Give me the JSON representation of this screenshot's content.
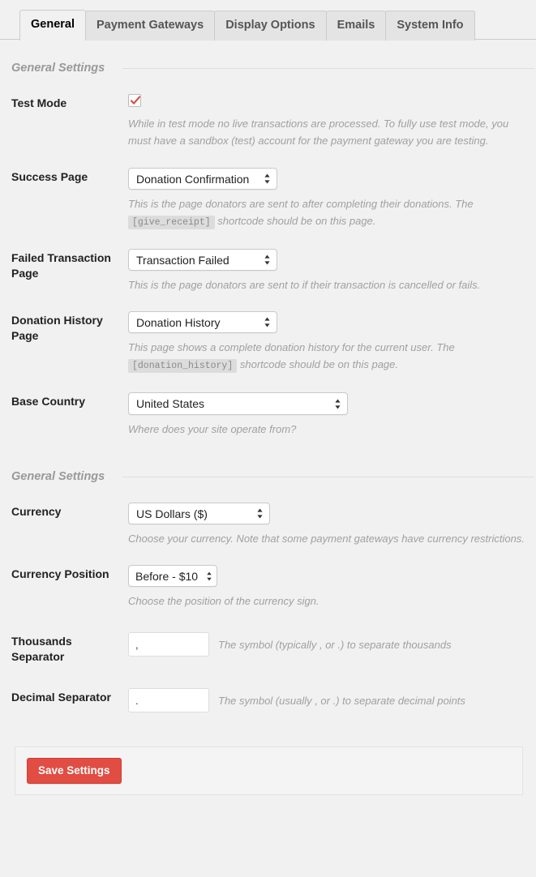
{
  "tabs": [
    {
      "label": "General",
      "active": true
    },
    {
      "label": "Payment Gateways",
      "active": false
    },
    {
      "label": "Display Options",
      "active": false
    },
    {
      "label": "Emails",
      "active": false
    },
    {
      "label": "System Info",
      "active": false
    }
  ],
  "sections": [
    {
      "title": "General Settings"
    },
    {
      "title": "General Settings"
    }
  ],
  "fields": {
    "test_mode": {
      "label": "Test Mode",
      "checked": true,
      "description": "While in test mode no live transactions are processed. To fully use test mode, you must have a sandbox (test) account for the payment gateway you are testing."
    },
    "success_page": {
      "label": "Success Page",
      "value": "Donation Confirmation",
      "desc_before": "This is the page donators are sent to after completing their donations. The",
      "shortcode": "[give_receipt]",
      "desc_after": "shortcode should be on this page."
    },
    "failed_page": {
      "label": "Failed Transaction Page",
      "value": "Transaction Failed",
      "description": "This is the page donators are sent to if their transaction is cancelled or fails."
    },
    "history_page": {
      "label": "Donation History Page",
      "value": "Donation History",
      "desc_before": "This page shows a complete donation history for the current user. The",
      "shortcode": "[donation_history]",
      "desc_after": "shortcode should be on this page."
    },
    "base_country": {
      "label": "Base Country",
      "value": "United States",
      "description": "Where does your site operate from?"
    },
    "currency": {
      "label": "Currency",
      "value": "US Dollars ($)",
      "description": "Choose your currency. Note that some payment gateways have currency restrictions."
    },
    "currency_position": {
      "label": "Currency Position",
      "value": "Before - $10",
      "description": "Choose the position of the currency sign."
    },
    "thousands_separator": {
      "label": "Thousands Separator",
      "value": ",",
      "description": "The symbol (typically , or .) to separate thousands"
    },
    "decimal_separator": {
      "label": "Decimal Separator",
      "value": ".",
      "description": "The symbol (usually , or .) to separate decimal points"
    }
  },
  "footer": {
    "save_label": "Save Settings"
  },
  "colors": {
    "accent": "#e14d43",
    "page_bg": "#f1f1f1",
    "tab_inactive_bg": "#e4e4e4",
    "checkmark": "#d54e43",
    "muted_text": "#a0a0a0"
  },
  "icons": {
    "select_arrows": "updown-chevron-icon",
    "checkmark": "check-icon"
  }
}
